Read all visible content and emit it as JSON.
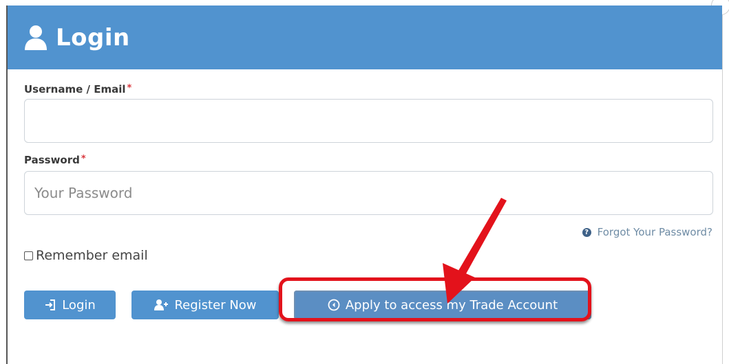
{
  "header": {
    "title": "Login",
    "icon": "user-icon"
  },
  "form": {
    "username_label": "Username / Email",
    "username_required": "*",
    "username_value": "",
    "username_placeholder": "",
    "password_label": "Password",
    "password_required": "*",
    "password_value": "",
    "password_placeholder": "Your Password",
    "forgot_label": "Forgot Your Password?",
    "forgot_icon": "question-circle-icon",
    "remember_label": "Remember email",
    "remember_checked": false
  },
  "buttons": {
    "login_label": "Login",
    "login_icon": "sign-in-icon",
    "register_label": "Register Now",
    "register_icon": "user-plus-icon",
    "apply_label": "Apply to access my Trade Account",
    "apply_icon": "arrow-circle-left-icon"
  },
  "annotation": {
    "highlight_color": "#e3121b",
    "arrow_color": "#e3121b"
  },
  "colors": {
    "primary": "#5193cf",
    "required": "#d9373d",
    "link": "#6f8ca5"
  }
}
